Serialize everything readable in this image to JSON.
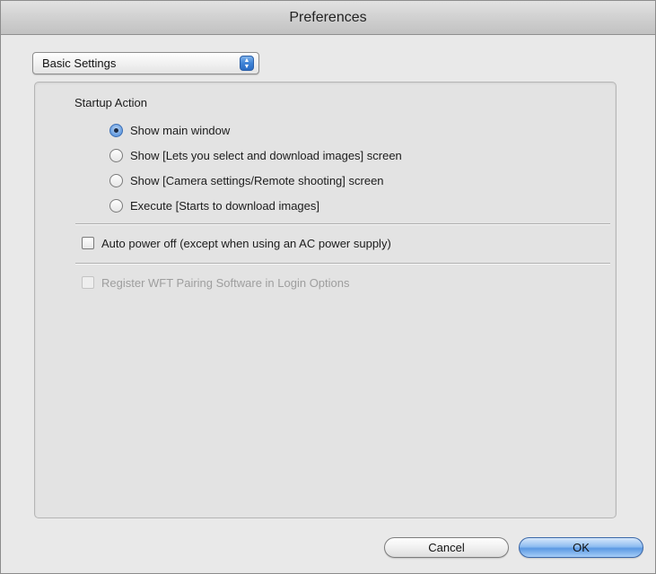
{
  "window": {
    "title": "Preferences"
  },
  "category_popup": {
    "selected": "Basic Settings",
    "icon": "updown-arrows-icon"
  },
  "startup": {
    "title": "Startup Action",
    "options": [
      {
        "label": "Show main window",
        "selected": true
      },
      {
        "label": "Show [Lets you select and download images] screen",
        "selected": false
      },
      {
        "label": "Show [Camera settings/Remote shooting] screen",
        "selected": false
      },
      {
        "label": "Execute [Starts to download images]",
        "selected": false
      }
    ]
  },
  "auto_power_off": {
    "label": "Auto power off (except when using an AC power supply)",
    "checked": false
  },
  "register_wft": {
    "label": "Register WFT Pairing Software in Login Options",
    "checked": false,
    "enabled": false
  },
  "buttons": {
    "cancel": "Cancel",
    "ok": "OK"
  },
  "colors": {
    "accent": "#4a83cf",
    "disabled_text": "#9e9e9e"
  }
}
